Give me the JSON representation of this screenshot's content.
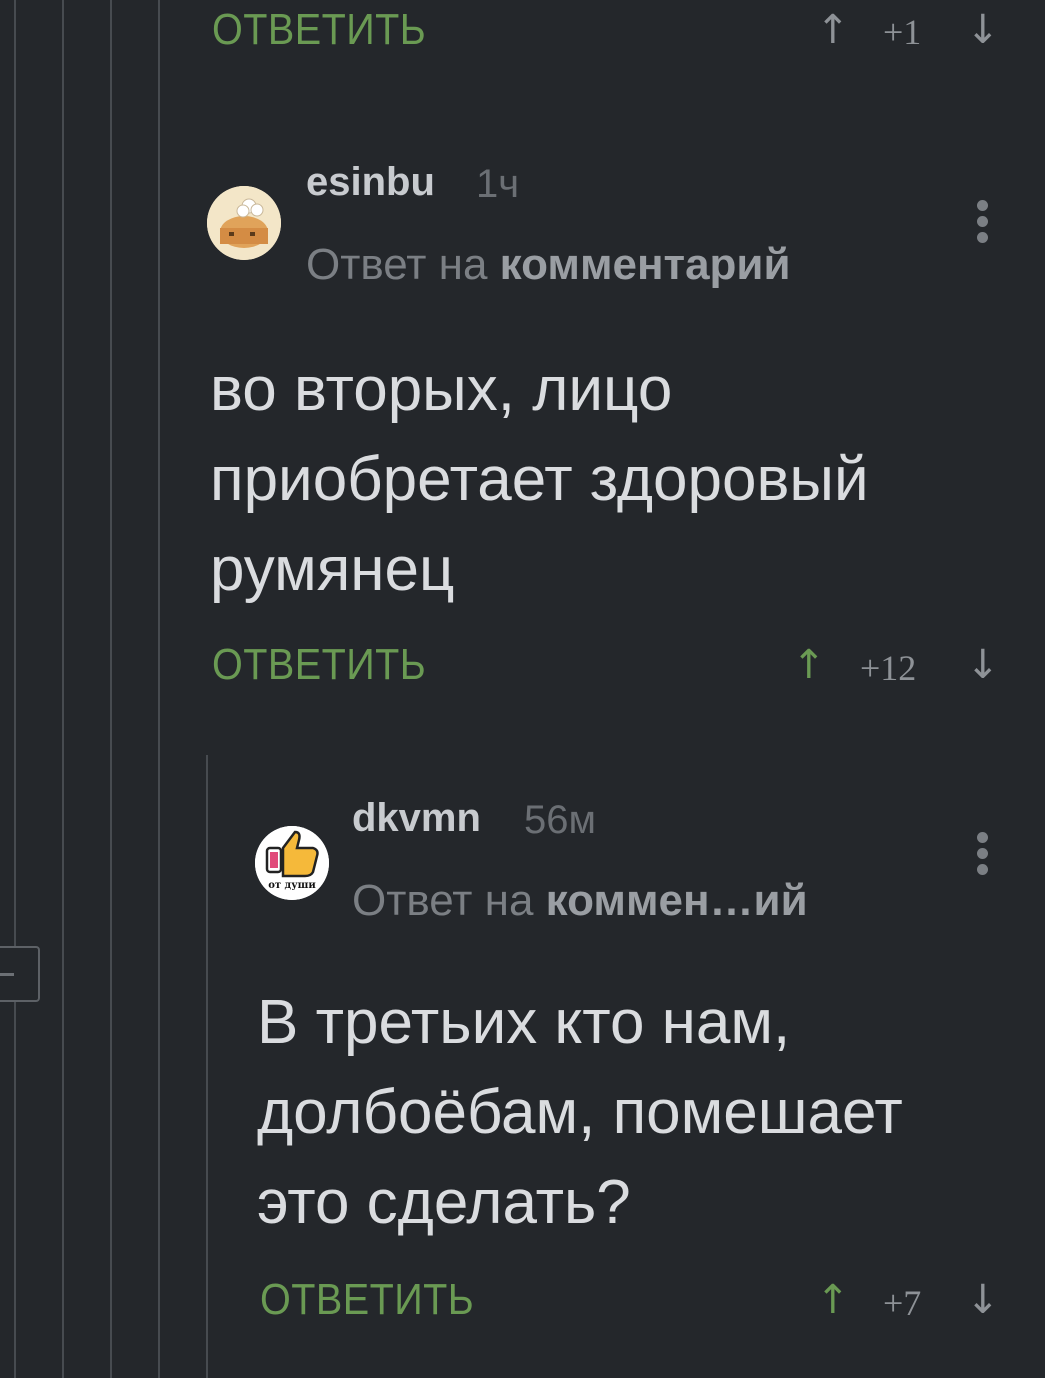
{
  "app": {
    "reply_label": "ОТВЕТИТЬ",
    "accent_color": "#6a9a53",
    "background_color": "#24272b"
  },
  "top_comment": {
    "reply_label": "ОТВЕТИТЬ",
    "score": "+1"
  },
  "comment_1": {
    "username": "esinbu",
    "time": "1ч",
    "reply_to_prefix": "Ответ на",
    "reply_to_link": "комментарий",
    "text_lines": [
      "во вторых, лицо",
      "приобретает здоровый",
      "румянец"
    ],
    "reply_label": "ОТВЕТИТЬ",
    "score": "+12",
    "avatar_icon": "chef-cake-icon"
  },
  "comment_2": {
    "username": "dkvmn",
    "time": "56м",
    "reply_to_prefix": "Ответ на",
    "reply_to_link": "коммен…ий",
    "text_lines": [
      "В третьих кто нам,",
      "долбоёбам, помешает",
      "это сделать?"
    ],
    "reply_label": "ОТВЕТИТЬ",
    "score": "+7",
    "avatar_icon": "thumbs-up-icon",
    "avatar_caption": "от души"
  },
  "icons": {
    "upvote": "arrow-up-icon",
    "downvote": "arrow-down-icon",
    "menu": "more-vertical-icon",
    "collapse": "collapse-thread-icon"
  }
}
